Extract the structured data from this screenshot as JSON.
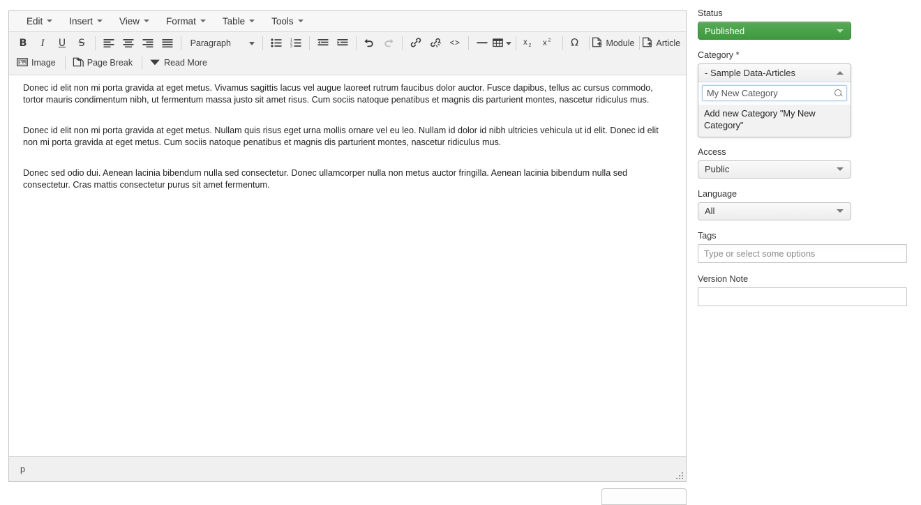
{
  "editor": {
    "menubar": [
      {
        "label": "Edit",
        "name": "menu-edit"
      },
      {
        "label": "Insert",
        "name": "menu-insert"
      },
      {
        "label": "View",
        "name": "menu-view"
      },
      {
        "label": "Format",
        "name": "menu-format"
      },
      {
        "label": "Table",
        "name": "menu-table"
      },
      {
        "label": "Tools",
        "name": "menu-tools"
      }
    ],
    "toolbar_row1": [
      {
        "type": "button",
        "icon": "B",
        "name": "bold-icon",
        "style": "bold"
      },
      {
        "type": "button",
        "icon": "I",
        "name": "italic-icon",
        "style": "italic"
      },
      {
        "type": "button",
        "icon": "U",
        "name": "underline-icon",
        "style": "underline"
      },
      {
        "type": "button",
        "icon": "S",
        "name": "strikethrough-icon",
        "style": "strike"
      },
      {
        "type": "sep"
      },
      {
        "type": "button",
        "icon": "align-left",
        "name": "align-left-icon"
      },
      {
        "type": "button",
        "icon": "align-center",
        "name": "align-center-icon"
      },
      {
        "type": "button",
        "icon": "align-right",
        "name": "align-right-icon"
      },
      {
        "type": "button",
        "icon": "align-justify",
        "name": "align-justify-icon"
      },
      {
        "type": "sep"
      },
      {
        "type": "select",
        "label": "Paragraph",
        "name": "block-format-select"
      },
      {
        "type": "sep"
      },
      {
        "type": "button",
        "icon": "bullet-list",
        "name": "bullet-list-icon"
      },
      {
        "type": "button",
        "icon": "numbered-list",
        "name": "numbered-list-icon"
      },
      {
        "type": "sep"
      },
      {
        "type": "button",
        "icon": "outdent",
        "name": "outdent-icon"
      },
      {
        "type": "button",
        "icon": "indent",
        "name": "indent-icon"
      },
      {
        "type": "sep"
      },
      {
        "type": "button",
        "icon": "undo",
        "name": "undo-icon"
      },
      {
        "type": "button",
        "icon": "redo",
        "name": "redo-icon"
      },
      {
        "type": "sep"
      },
      {
        "type": "button",
        "icon": "link",
        "name": "link-icon"
      },
      {
        "type": "button",
        "icon": "unlink",
        "name": "unlink-icon"
      },
      {
        "type": "button",
        "icon": "source-code",
        "name": "source-code-icon"
      },
      {
        "type": "sep"
      },
      {
        "type": "button",
        "icon": "horizontal-rule",
        "name": "horizontal-rule-icon"
      },
      {
        "type": "button",
        "icon": "table",
        "name": "table-icon",
        "caret": true
      },
      {
        "type": "sep"
      },
      {
        "type": "button",
        "icon": "subscript",
        "name": "subscript-icon"
      },
      {
        "type": "button",
        "icon": "superscript",
        "name": "superscript-icon"
      },
      {
        "type": "sep"
      },
      {
        "type": "button",
        "icon": "omega",
        "name": "special-character-icon"
      },
      {
        "type": "sep"
      },
      {
        "type": "labeled",
        "icon": "page-plus",
        "label": "Module",
        "name": "insert-module-button"
      },
      {
        "type": "sep"
      },
      {
        "type": "labeled",
        "icon": "page-plus",
        "label": "Article",
        "name": "insert-article-button"
      }
    ],
    "toolbar_row2": [
      {
        "type": "labeled",
        "icon": "image",
        "label": "Image",
        "name": "insert-image-button"
      },
      {
        "type": "sep"
      },
      {
        "type": "labeled",
        "icon": "page-break",
        "label": "Page Break",
        "name": "insert-page-break-button"
      },
      {
        "type": "sep"
      },
      {
        "type": "labeled",
        "icon": "read-more",
        "label": "Read More",
        "name": "insert-read-more-button"
      }
    ],
    "content": [
      "Donec id elit non mi porta gravida at eget metus. Vivamus sagittis lacus vel augue laoreet rutrum faucibus dolor auctor. Fusce dapibus, tellus ac cursus commodo, tortor mauris condimentum nibh, ut fermentum massa justo sit amet risus. Cum sociis natoque penatibus et magnis dis parturient montes, nascetur ridiculus mus.",
      "Donec id elit non mi porta gravida at eget metus. Nullam quis risus eget urna mollis ornare vel eu leo. Nullam id dolor id nibh ultricies vehicula ut id elit. Donec id elit non mi porta gravida at eget metus. Cum sociis natoque penatibus et magnis dis parturient montes, nascetur ridiculus mus.",
      "Donec sed odio dui. Aenean lacinia bibendum nulla sed consectetur. Donec ullamcorper nulla non metus auctor fringilla. Aenean lacinia bibendum nulla sed consectetur. Cras mattis consectetur purus sit amet fermentum."
    ],
    "statusbar": {
      "path": "p"
    }
  },
  "sidebar": {
    "status": {
      "label": "Status",
      "value": "Published",
      "color": "#48a148"
    },
    "category": {
      "label": "Category *",
      "selected": "- Sample Data-Articles",
      "search_value": "My New Category",
      "options": [
        "Add new Category \"My New Category\""
      ]
    },
    "access": {
      "label": "Access",
      "value": "Public"
    },
    "language": {
      "label": "Language",
      "value": "All"
    },
    "tags": {
      "label": "Tags",
      "placeholder": "Type or select some options",
      "value": ""
    },
    "version_note": {
      "label": "Version Note",
      "value": ""
    }
  }
}
